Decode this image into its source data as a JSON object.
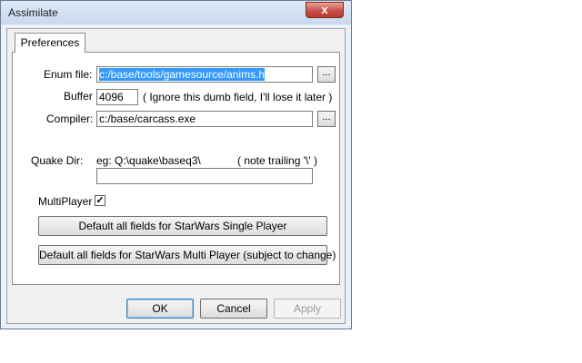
{
  "window": {
    "title": "Assimilate",
    "close_glyph": "x"
  },
  "tabs": [
    {
      "label": "Preferences",
      "selected": true
    }
  ],
  "fields": {
    "enum_file": {
      "label": "Enum file:",
      "value": "c:/base/tools/gamesource/anims.h",
      "browse": "..."
    },
    "buffer": {
      "label": "Buffer",
      "value": "4096",
      "note": "( Ignore this dumb field, I'll lose it later )"
    },
    "compiler": {
      "label": "Compiler:",
      "value": "c:/base/carcass.exe",
      "browse": "..."
    },
    "quake_dir": {
      "label": "Quake Dir:",
      "example": "eg: Q:\\quake\\baseq3\\",
      "note": "( note trailing '\\' )",
      "value": ""
    },
    "multiplayer": {
      "label": "MultiPlayer",
      "checked": true,
      "check_glyph": "✓"
    }
  },
  "buttons": {
    "default_single": "Default all fields for StarWars Single Player",
    "default_multi": "Default all fields for StarWars Multi Player (subject to change)",
    "ok": "OK",
    "cancel": "Cancel",
    "apply": "Apply"
  },
  "colors": {
    "selection": "#3399ff",
    "close_button": "#c75050"
  }
}
